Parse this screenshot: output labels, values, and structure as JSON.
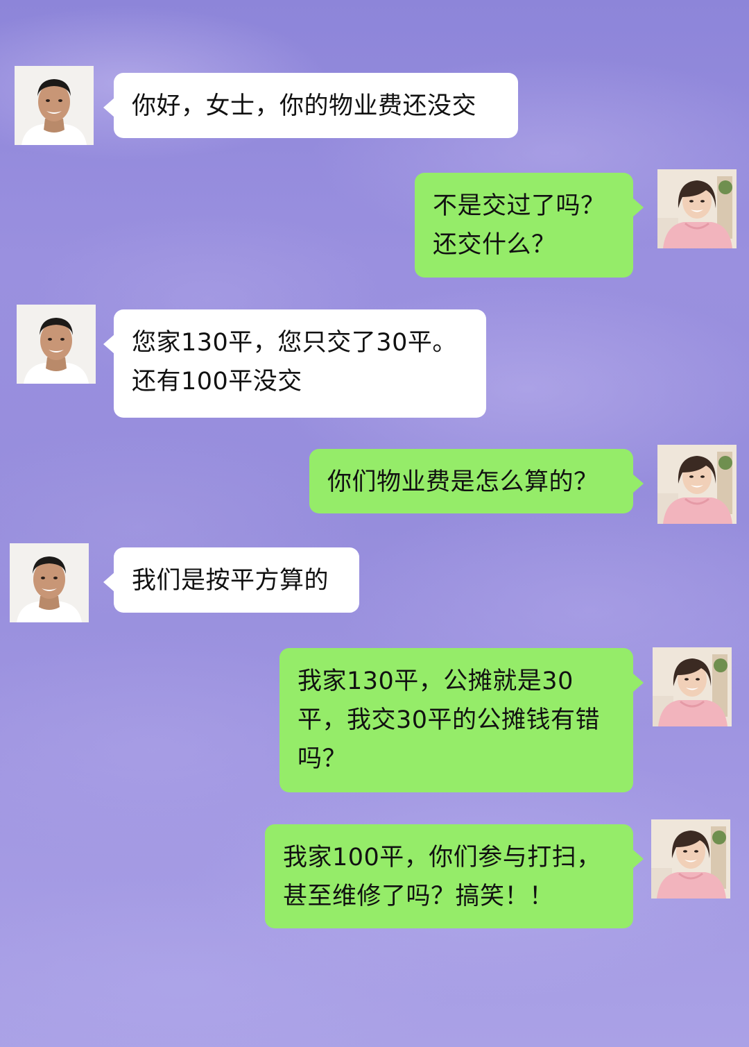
{
  "theme": {
    "incoming_bubble_color": "#ffffff",
    "outgoing_bubble_color": "#95ec69",
    "background_color": "#968ddc"
  },
  "participants": {
    "agent": {
      "avatar_icon": "man-avatar-icon"
    },
    "owner": {
      "avatar_icon": "woman-avatar-icon"
    }
  },
  "messages": [
    {
      "sender": "agent",
      "side": "left",
      "text": "你好，女士，你的物业费还没交"
    },
    {
      "sender": "owner",
      "side": "right",
      "text": "不是交过了吗？\n还交什么？"
    },
    {
      "sender": "agent",
      "side": "left",
      "text": "您家130平，您只交了30平。\n还有100平没交"
    },
    {
      "sender": "owner",
      "side": "right",
      "text": "你们物业费是怎么算的？"
    },
    {
      "sender": "agent",
      "side": "left",
      "text": "我们是按平方算的"
    },
    {
      "sender": "owner",
      "side": "right",
      "text": "我家130平，公摊就是30\n平，我交30平的公摊钱有错\n吗？"
    },
    {
      "sender": "owner",
      "side": "right",
      "text": "我家100平，你们参与打扫，\n甚至维修了吗？搞笑！！"
    }
  ]
}
